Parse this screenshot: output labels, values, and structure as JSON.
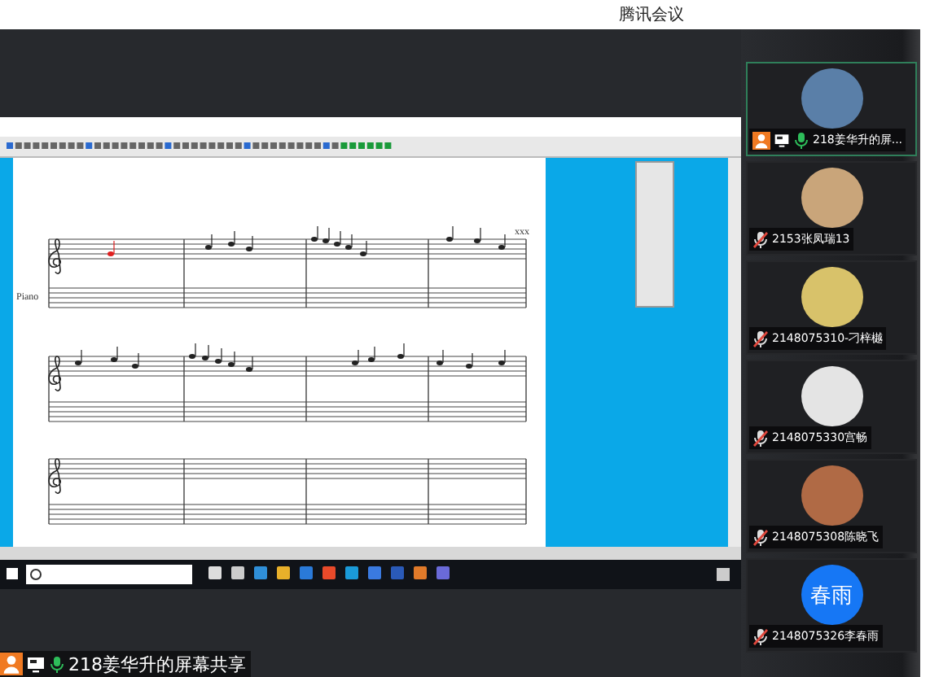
{
  "app": {
    "title": "腾讯会议"
  },
  "shared_screen": {
    "score": {
      "instrument": "Piano",
      "composer": "xxx"
    },
    "sharer": {
      "label": "218姜华升的屏幕共享",
      "host": true,
      "sharing": true,
      "muted": false
    }
  },
  "participants": [
    {
      "name": "218姜华升的屏...",
      "host": true,
      "sharing": true,
      "muted": false,
      "selected": true,
      "avatar": {
        "kind": "photo",
        "color": "#5a7fa8"
      }
    },
    {
      "name": "2153张凤瑞13",
      "host": false,
      "sharing": false,
      "muted": true,
      "selected": false,
      "avatar": {
        "kind": "photo",
        "color": "#c9a57a"
      }
    },
    {
      "name": "2148075310-刁梓樾",
      "host": false,
      "sharing": false,
      "muted": true,
      "selected": false,
      "avatar": {
        "kind": "photo",
        "color": "#d8c26a"
      }
    },
    {
      "name": "2148075330宫畅",
      "host": false,
      "sharing": false,
      "muted": true,
      "selected": false,
      "avatar": {
        "kind": "photo",
        "color": "#e4e4e4"
      }
    },
    {
      "name": "2148075308陈晓飞",
      "host": false,
      "sharing": false,
      "muted": true,
      "selected": false,
      "avatar": {
        "kind": "photo",
        "color": "#b06a45"
      }
    },
    {
      "name": "2148075326李春雨",
      "host": false,
      "sharing": false,
      "muted": true,
      "selected": false,
      "avatar": {
        "kind": "text",
        "text": "春雨",
        "color": "#1677f5"
      }
    }
  ]
}
